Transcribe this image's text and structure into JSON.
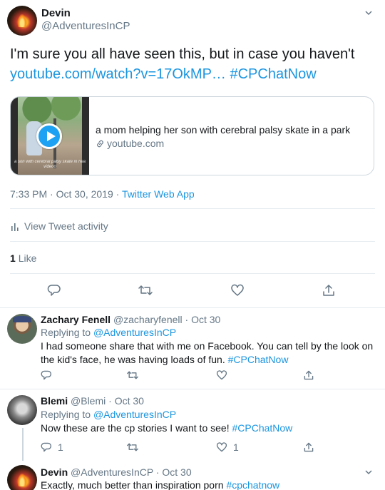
{
  "main_tweet": {
    "author_name": "Devin",
    "author_handle": "@AdventuresInCP",
    "text_line1": "I'm sure you all have seen this, but in case you haven't",
    "link_text": "youtube.com/watch?v=17OkMP…",
    "hashtag": "#CPChatNow",
    "card": {
      "title": "a mom helping her son with cerebral palsy skate in a park",
      "domain": "youtube.com",
      "thumbnail_caption": "a son with cerebral palsy skate in hea videoo"
    },
    "time": "7:33 PM",
    "date": "Oct 30, 2019",
    "source": "Twitter Web App",
    "separator": " · ",
    "activity_label": "View Tweet activity",
    "like_count": "1",
    "like_label": "Like"
  },
  "replies": [
    {
      "author_name": "Zachary Fenell",
      "author_handle": "@zacharyfenell",
      "date": "Oct 30",
      "replying_label": "Replying to",
      "replying_handle": "@AdventuresInCP",
      "text_line1": "I had someone share that with me on Facebook. You can tell by the look on",
      "text_line2": "the kid's face, he was having loads of fun.",
      "hashtag": "#CPChatNow",
      "reply_count": "",
      "like_count": ""
    },
    {
      "author_name": "Blemi",
      "author_handle": "@Blemi",
      "date": "Oct 30",
      "replying_label": "Replying to",
      "replying_handle": "@AdventuresInCP",
      "text_line1": "Now these are the cp stories I want to see!",
      "hashtag": "#CPChatNow",
      "reply_count": "1",
      "like_count": "1"
    },
    {
      "author_name": "Devin",
      "author_handle": "@AdventuresInCP",
      "date": "Oct 30",
      "text_line1": "Exactly, much better than inspiration porn",
      "hashtag": "#cpchatnow"
    }
  ],
  "icons": {
    "reply": "reply-icon",
    "retweet": "retweet-icon",
    "like": "heart-icon",
    "share": "share-icon",
    "more": "chevron-down-icon",
    "activity": "bar-chart-icon",
    "link": "link-icon",
    "play": "play-icon"
  },
  "colors": {
    "accent": "#1b95e0",
    "muted": "#657786",
    "text": "#14171a",
    "border": "#e6ecf0"
  }
}
